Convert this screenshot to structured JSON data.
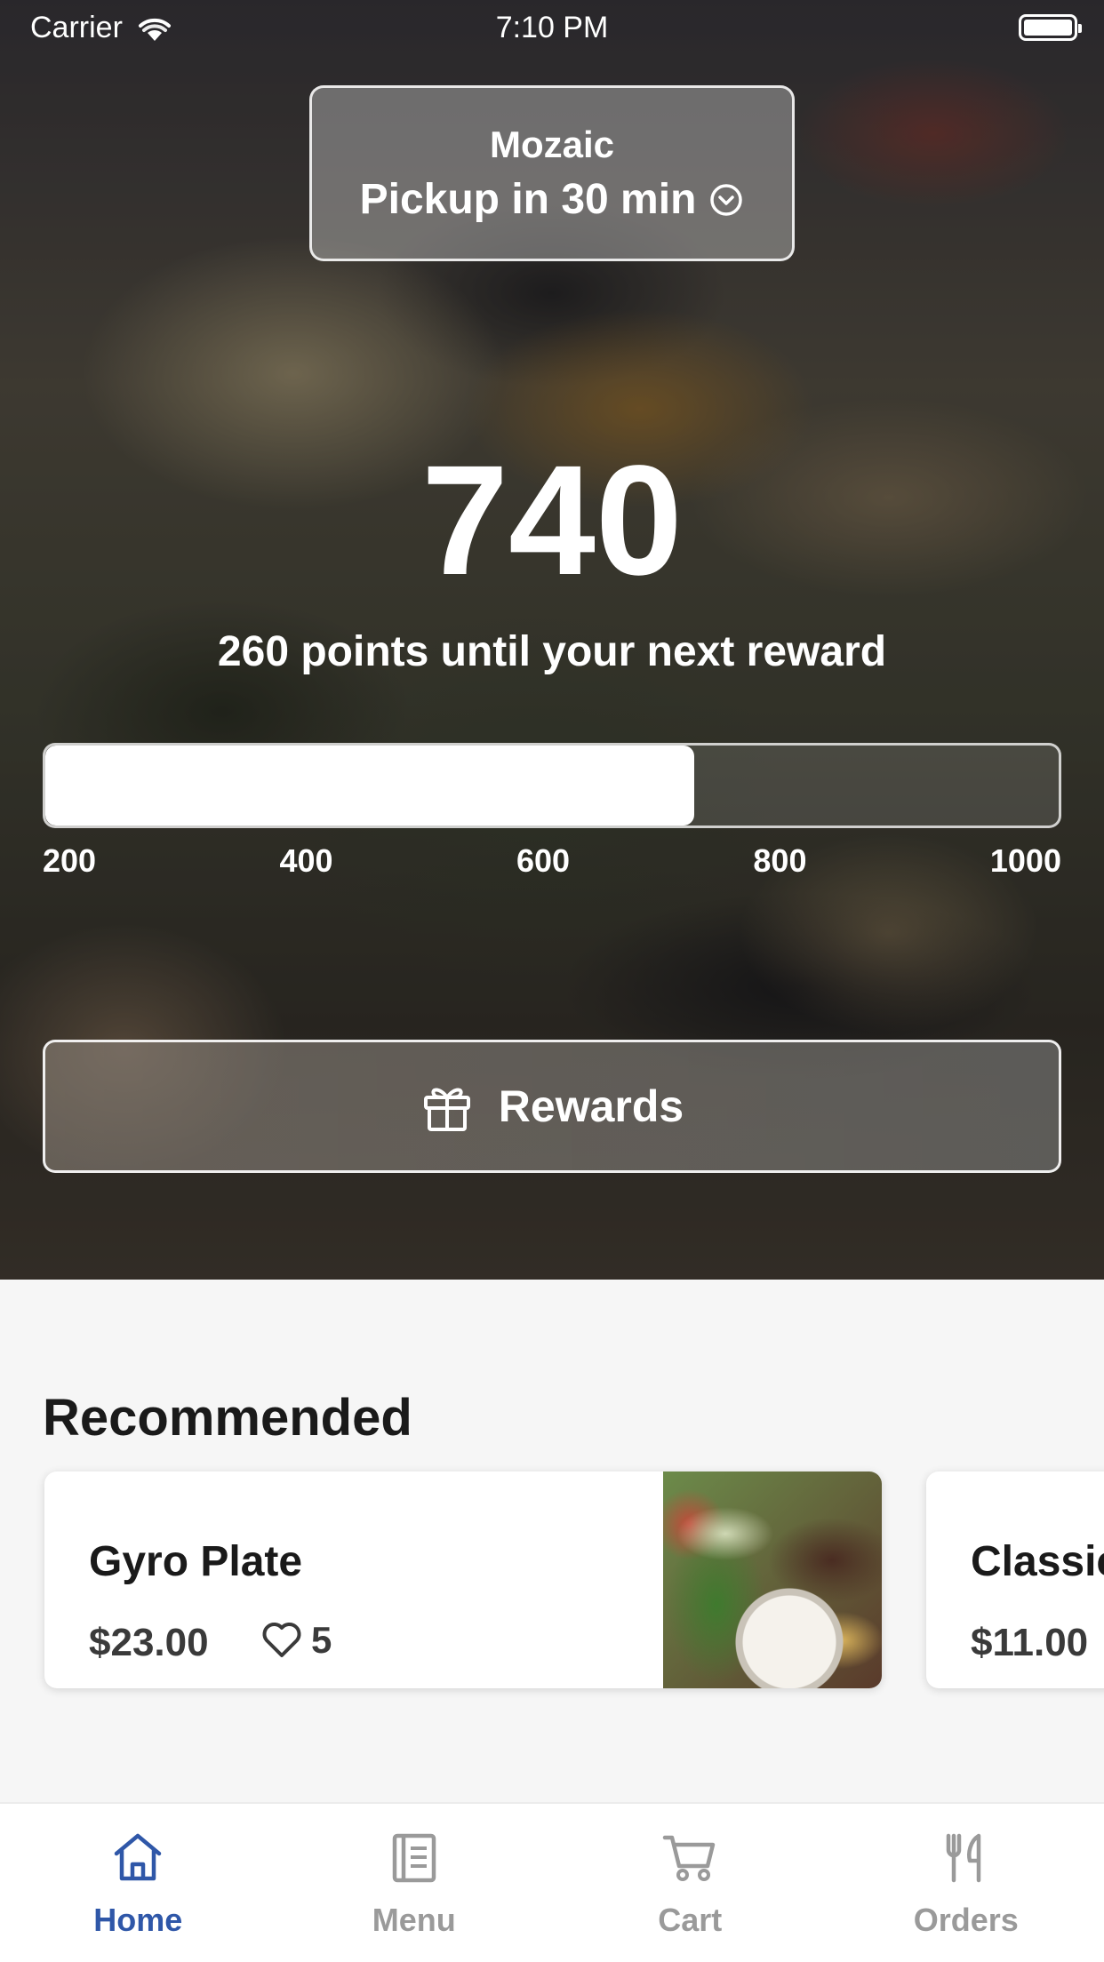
{
  "status_bar": {
    "carrier": "Carrier",
    "time": "7:10 PM"
  },
  "location": {
    "name": "Mozaic",
    "pickup": "Pickup in 30 min"
  },
  "rewards": {
    "points": "740",
    "caption": "260 points until your next reward",
    "progress_fraction": 0.64,
    "ticks": [
      "200",
      "400",
      "600",
      "800",
      "1000"
    ],
    "button_label": "Rewards"
  },
  "recommended": {
    "title": "Recommended",
    "items": [
      {
        "name": "Gyro Plate",
        "price": "$23.00",
        "likes": "5"
      },
      {
        "name": "Classic",
        "price": "$11.00"
      }
    ]
  },
  "tabs": [
    {
      "label": "Home",
      "icon": "home-icon",
      "active": true
    },
    {
      "label": "Menu",
      "icon": "menu-icon",
      "active": false
    },
    {
      "label": "Cart",
      "icon": "cart-icon",
      "active": false
    },
    {
      "label": "Orders",
      "icon": "fork-knife-icon",
      "active": false
    }
  ],
  "colors": {
    "accent": "#2f57a8",
    "inactive_tab": "#9a9a9a"
  }
}
